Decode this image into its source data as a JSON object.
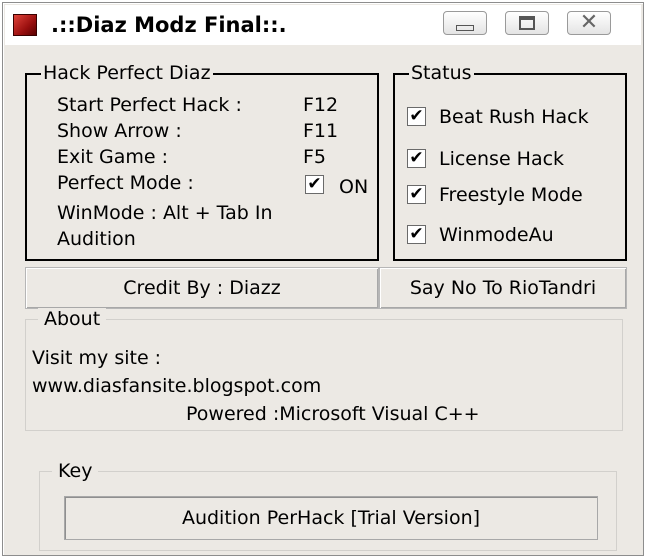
{
  "window": {
    "title": ".::Diaz Modz Final::.",
    "icon": "app-icon-red-square"
  },
  "hack_group": {
    "legend": "Hack Perfect Diaz",
    "rows": [
      {
        "label": "Start Perfect Hack :",
        "key": "F12"
      },
      {
        "label": "Show Arrow :",
        "key": "F11"
      },
      {
        "label": "Exit Game :",
        "key": "F5"
      },
      {
        "label": "Perfect Mode :",
        "key": "ON",
        "checked": true
      }
    ],
    "winmode_line1": "WinMode : Alt + Tab In",
    "winmode_line2": "Audition"
  },
  "status_group": {
    "legend": "Status",
    "items": [
      {
        "label": "Beat Rush Hack",
        "checked": true
      },
      {
        "label": "License Hack",
        "checked": true
      },
      {
        "label": "Freestyle Mode",
        "checked": true
      },
      {
        "label": "WinmodeAu",
        "checked": true
      }
    ]
  },
  "buttons": {
    "credit": "Credit By : Diazz",
    "say_no": "Say No To RioTandri"
  },
  "about": {
    "legend": "About",
    "visit": "Visit my site :",
    "url": "www.diasfansite.blogspot.com",
    "powered": "Powered :Microsoft Visual C++"
  },
  "key": {
    "legend": "Key",
    "value": "Audition PerHack [Trial Version]"
  },
  "check_glyph": "✔",
  "colors": {
    "window_bg": "#ece9e4",
    "icon_red": "#9a0f0f"
  }
}
